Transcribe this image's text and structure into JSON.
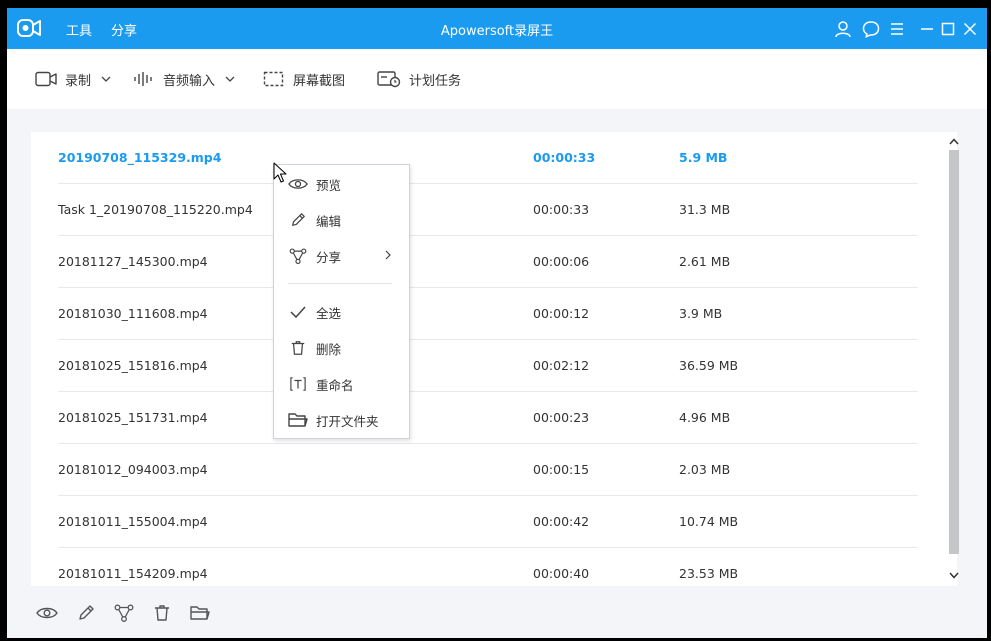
{
  "header": {
    "title": "Apowersoft录屏王",
    "menu": [
      "工具",
      "分享"
    ]
  },
  "toolbar": {
    "record_label": "录制",
    "audio_label": "音频输入",
    "screenshot_label": "屏幕截图",
    "schedule_label": "计划任务"
  },
  "files": [
    {
      "name": "20190708_115329.mp4",
      "duration": "00:00:33",
      "size": "5.9 MB"
    },
    {
      "name": "Task 1_20190708_115220.mp4",
      "duration": "00:00:33",
      "size": "31.3 MB"
    },
    {
      "name": "20181127_145300.mp4",
      "duration": "00:00:06",
      "size": "2.61 MB"
    },
    {
      "name": "20181030_111608.mp4",
      "duration": "00:00:12",
      "size": "3.9 MB"
    },
    {
      "name": "20181025_151816.mp4",
      "duration": "00:02:12",
      "size": "36.59 MB"
    },
    {
      "name": "20181025_151731.mp4",
      "duration": "00:00:23",
      "size": "4.96 MB"
    },
    {
      "name": "20181012_094003.mp4",
      "duration": "00:00:15",
      "size": "2.03 MB"
    },
    {
      "name": "20181011_155004.mp4",
      "duration": "00:00:42",
      "size": "10.74 MB"
    },
    {
      "name": "20181011_154209.mp4",
      "duration": "00:00:40",
      "size": "23.53 MB"
    }
  ],
  "context_menu": {
    "preview": "预览",
    "edit": "编辑",
    "share": "分享",
    "select_all": "全选",
    "delete": "删除",
    "rename": "重命名",
    "open_folder": "打开文件夹"
  },
  "colors": {
    "accent": "#1a9bf0",
    "titlebar": "#1a9bf0",
    "selected_text": "#1a9bf0"
  },
  "icons": {
    "titlebar": [
      "user-icon",
      "chat-icon",
      "menu-icon",
      "minimize-icon",
      "maximize-icon",
      "close-icon"
    ],
    "bottombar": [
      "eye-icon",
      "pencil-icon",
      "share-icon",
      "trash-icon",
      "folder-icon"
    ]
  }
}
